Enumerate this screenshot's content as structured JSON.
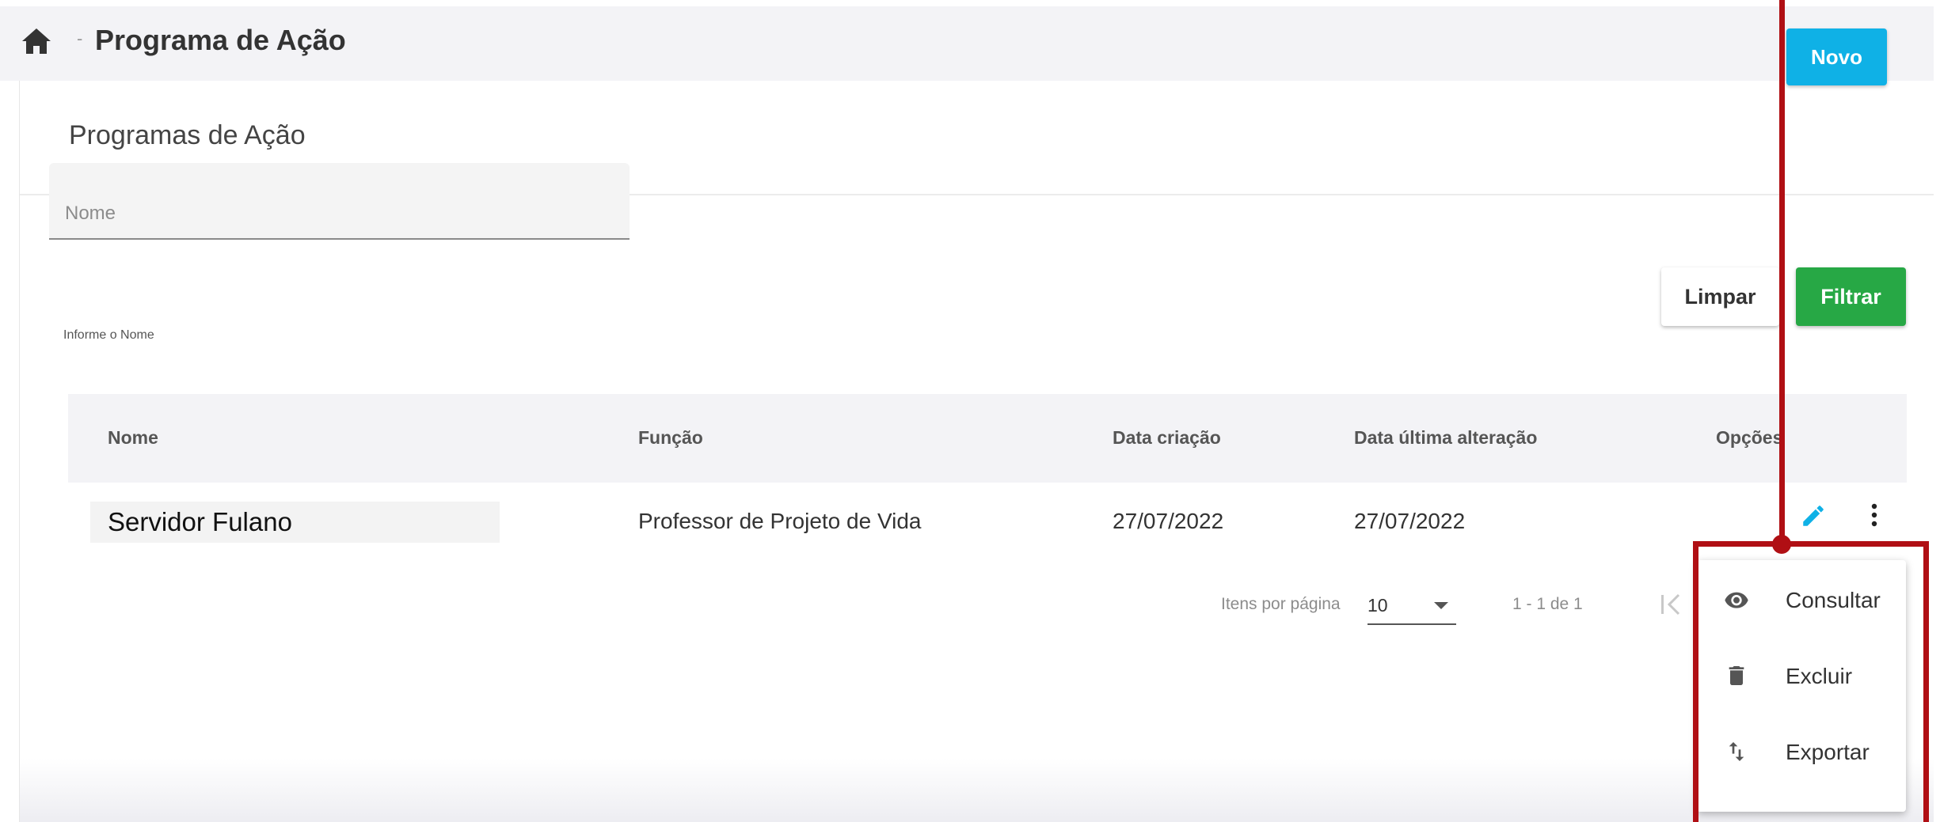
{
  "breadcrumb": {
    "home_icon": "home-icon",
    "separator": "-",
    "title": "Programa de Ação"
  },
  "card": {
    "title": "Programas de Ação",
    "new_button": "Novo"
  },
  "filter": {
    "name_placeholder": "Nome",
    "name_value": "",
    "name_hint": "Informe o Nome",
    "clear_button": "Limpar",
    "filter_button": "Filtrar"
  },
  "table": {
    "columns": [
      "Nome",
      "Função",
      "Data criação",
      "Data última alteração",
      "Opções"
    ],
    "rows": [
      {
        "nome": "Servidor Fulano",
        "funcao": "Professor de Projeto de Vida",
        "data_criacao": "27/07/2022",
        "data_alteracao": "27/07/2022"
      }
    ]
  },
  "paginator": {
    "items_per_page_label": "Itens por página",
    "items_per_page_value": "10",
    "range_label": "1 - 1 de 1"
  },
  "context_menu": {
    "items": [
      {
        "label": "Consultar",
        "icon": "eye-icon"
      },
      {
        "label": "Excluir",
        "icon": "trash-icon"
      },
      {
        "label": "Exportar",
        "icon": "import-export-icon"
      }
    ]
  },
  "colors": {
    "primary": "#0fb1e6",
    "success": "#27a845",
    "annotation": "#b00f14"
  }
}
